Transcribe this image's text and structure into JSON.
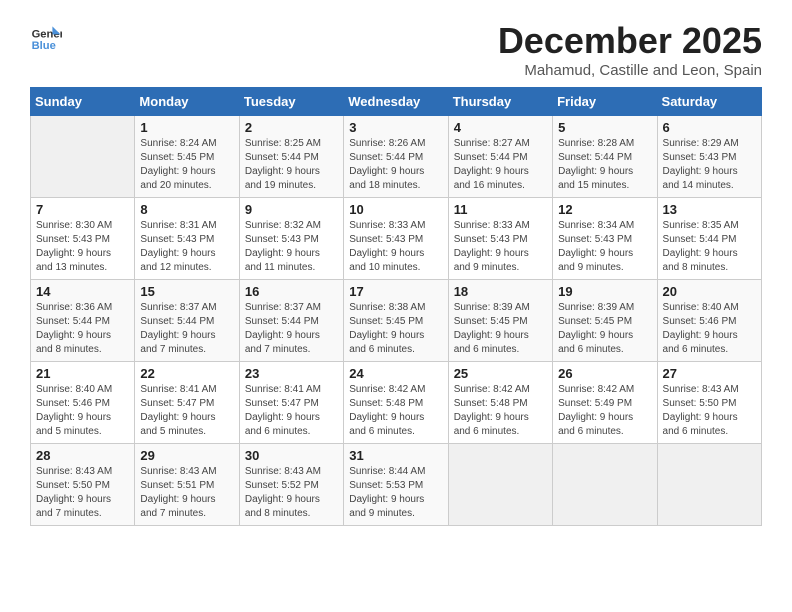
{
  "logo": {
    "name": "GeneralBlue",
    "name_part1": "General",
    "name_part2": "Blue"
  },
  "header": {
    "title": "December 2025",
    "subtitle": "Mahamud, Castille and Leon, Spain"
  },
  "weekdays": [
    "Sunday",
    "Monday",
    "Tuesday",
    "Wednesday",
    "Thursday",
    "Friday",
    "Saturday"
  ],
  "weeks": [
    [
      {
        "day": "",
        "sunrise": "",
        "sunset": "",
        "daylight": ""
      },
      {
        "day": "1",
        "sunrise": "Sunrise: 8:24 AM",
        "sunset": "Sunset: 5:45 PM",
        "daylight": "Daylight: 9 hours and 20 minutes."
      },
      {
        "day": "2",
        "sunrise": "Sunrise: 8:25 AM",
        "sunset": "Sunset: 5:44 PM",
        "daylight": "Daylight: 9 hours and 19 minutes."
      },
      {
        "day": "3",
        "sunrise": "Sunrise: 8:26 AM",
        "sunset": "Sunset: 5:44 PM",
        "daylight": "Daylight: 9 hours and 18 minutes."
      },
      {
        "day": "4",
        "sunrise": "Sunrise: 8:27 AM",
        "sunset": "Sunset: 5:44 PM",
        "daylight": "Daylight: 9 hours and 16 minutes."
      },
      {
        "day": "5",
        "sunrise": "Sunrise: 8:28 AM",
        "sunset": "Sunset: 5:44 PM",
        "daylight": "Daylight: 9 hours and 15 minutes."
      },
      {
        "day": "6",
        "sunrise": "Sunrise: 8:29 AM",
        "sunset": "Sunset: 5:43 PM",
        "daylight": "Daylight: 9 hours and 14 minutes."
      }
    ],
    [
      {
        "day": "7",
        "sunrise": "Sunrise: 8:30 AM",
        "sunset": "Sunset: 5:43 PM",
        "daylight": "Daylight: 9 hours and 13 minutes."
      },
      {
        "day": "8",
        "sunrise": "Sunrise: 8:31 AM",
        "sunset": "Sunset: 5:43 PM",
        "daylight": "Daylight: 9 hours and 12 minutes."
      },
      {
        "day": "9",
        "sunrise": "Sunrise: 8:32 AM",
        "sunset": "Sunset: 5:43 PM",
        "daylight": "Daylight: 9 hours and 11 minutes."
      },
      {
        "day": "10",
        "sunrise": "Sunrise: 8:33 AM",
        "sunset": "Sunset: 5:43 PM",
        "daylight": "Daylight: 9 hours and 10 minutes."
      },
      {
        "day": "11",
        "sunrise": "Sunrise: 8:33 AM",
        "sunset": "Sunset: 5:43 PM",
        "daylight": "Daylight: 9 hours and 9 minutes."
      },
      {
        "day": "12",
        "sunrise": "Sunrise: 8:34 AM",
        "sunset": "Sunset: 5:43 PM",
        "daylight": "Daylight: 9 hours and 9 minutes."
      },
      {
        "day": "13",
        "sunrise": "Sunrise: 8:35 AM",
        "sunset": "Sunset: 5:44 PM",
        "daylight": "Daylight: 9 hours and 8 minutes."
      }
    ],
    [
      {
        "day": "14",
        "sunrise": "Sunrise: 8:36 AM",
        "sunset": "Sunset: 5:44 PM",
        "daylight": "Daylight: 9 hours and 8 minutes."
      },
      {
        "day": "15",
        "sunrise": "Sunrise: 8:37 AM",
        "sunset": "Sunset: 5:44 PM",
        "daylight": "Daylight: 9 hours and 7 minutes."
      },
      {
        "day": "16",
        "sunrise": "Sunrise: 8:37 AM",
        "sunset": "Sunset: 5:44 PM",
        "daylight": "Daylight: 9 hours and 7 minutes."
      },
      {
        "day": "17",
        "sunrise": "Sunrise: 8:38 AM",
        "sunset": "Sunset: 5:45 PM",
        "daylight": "Daylight: 9 hours and 6 minutes."
      },
      {
        "day": "18",
        "sunrise": "Sunrise: 8:39 AM",
        "sunset": "Sunset: 5:45 PM",
        "daylight": "Daylight: 9 hours and 6 minutes."
      },
      {
        "day": "19",
        "sunrise": "Sunrise: 8:39 AM",
        "sunset": "Sunset: 5:45 PM",
        "daylight": "Daylight: 9 hours and 6 minutes."
      },
      {
        "day": "20",
        "sunrise": "Sunrise: 8:40 AM",
        "sunset": "Sunset: 5:46 PM",
        "daylight": "Daylight: 9 hours and 6 minutes."
      }
    ],
    [
      {
        "day": "21",
        "sunrise": "Sunrise: 8:40 AM",
        "sunset": "Sunset: 5:46 PM",
        "daylight": "Daylight: 9 hours and 5 minutes."
      },
      {
        "day": "22",
        "sunrise": "Sunrise: 8:41 AM",
        "sunset": "Sunset: 5:47 PM",
        "daylight": "Daylight: 9 hours and 5 minutes."
      },
      {
        "day": "23",
        "sunrise": "Sunrise: 8:41 AM",
        "sunset": "Sunset: 5:47 PM",
        "daylight": "Daylight: 9 hours and 6 minutes."
      },
      {
        "day": "24",
        "sunrise": "Sunrise: 8:42 AM",
        "sunset": "Sunset: 5:48 PM",
        "daylight": "Daylight: 9 hours and 6 minutes."
      },
      {
        "day": "25",
        "sunrise": "Sunrise: 8:42 AM",
        "sunset": "Sunset: 5:48 PM",
        "daylight": "Daylight: 9 hours and 6 minutes."
      },
      {
        "day": "26",
        "sunrise": "Sunrise: 8:42 AM",
        "sunset": "Sunset: 5:49 PM",
        "daylight": "Daylight: 9 hours and 6 minutes."
      },
      {
        "day": "27",
        "sunrise": "Sunrise: 8:43 AM",
        "sunset": "Sunset: 5:50 PM",
        "daylight": "Daylight: 9 hours and 6 minutes."
      }
    ],
    [
      {
        "day": "28",
        "sunrise": "Sunrise: 8:43 AM",
        "sunset": "Sunset: 5:50 PM",
        "daylight": "Daylight: 9 hours and 7 minutes."
      },
      {
        "day": "29",
        "sunrise": "Sunrise: 8:43 AM",
        "sunset": "Sunset: 5:51 PM",
        "daylight": "Daylight: 9 hours and 7 minutes."
      },
      {
        "day": "30",
        "sunrise": "Sunrise: 8:43 AM",
        "sunset": "Sunset: 5:52 PM",
        "daylight": "Daylight: 9 hours and 8 minutes."
      },
      {
        "day": "31",
        "sunrise": "Sunrise: 8:44 AM",
        "sunset": "Sunset: 5:53 PM",
        "daylight": "Daylight: 9 hours and 9 minutes."
      },
      {
        "day": "",
        "sunrise": "",
        "sunset": "",
        "daylight": ""
      },
      {
        "day": "",
        "sunrise": "",
        "sunset": "",
        "daylight": ""
      },
      {
        "day": "",
        "sunrise": "",
        "sunset": "",
        "daylight": ""
      }
    ]
  ]
}
